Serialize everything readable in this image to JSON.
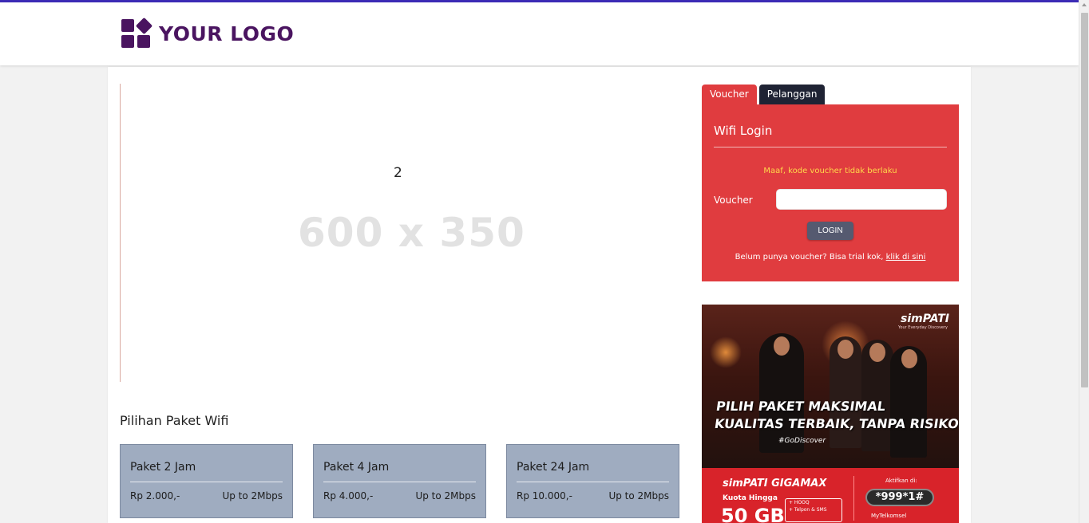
{
  "header": {
    "logo_text": "YOUR LOGO"
  },
  "slider": {
    "slide_number": "2",
    "placeholder_text": "600 x 350"
  },
  "packages": {
    "title": "Pilihan Paket Wifi",
    "items": [
      {
        "name": "Paket 2 Jam",
        "price": "Rp 2.000,-",
        "speed": "Up to 2Mbps"
      },
      {
        "name": "Paket 4 Jam",
        "price": "Rp 4.000,-",
        "speed": "Up to 2Mbps"
      },
      {
        "name": "Paket 24 Jam",
        "price": "Rp 10.000,-",
        "speed": "Up to 2Mbps"
      }
    ]
  },
  "login": {
    "tabs": [
      {
        "label": "Voucher",
        "active": true
      },
      {
        "label": "Pelanggan",
        "active": false
      }
    ],
    "title": "Wifi Login",
    "error": "Maaf, kode voucher tidak berlaku",
    "voucher_label": "Voucher",
    "voucher_value": "",
    "button_label": "LOGIN",
    "trial_text": "Belum punya voucher? Bisa trial kok,",
    "trial_link": "klik di sini"
  },
  "ad": {
    "brand": "simPATI",
    "brand_sub": "Your Everyday Discovery",
    "headline1": "PILIH PAKET MAKSIMAL",
    "headline2": "KUALITAS TERBAIK, TANPA RISIKO",
    "hashtag": "#GoDiscover",
    "product": "simPATI GIGAMAX",
    "quota_label": "Kuota Hingga",
    "quota_value": "50 GB",
    "features": [
      "+ HOOQ",
      "+ Telpon & SMS"
    ],
    "activate_label": "Aktifkan di:",
    "code": "*999*1#",
    "app_name": "MyTelkomsel"
  },
  "colors": {
    "accent_red": "#e03c3f",
    "tab_dark": "#1f2334",
    "logo_purple": "#4a1460",
    "top_border": "#3b2bb5",
    "package_bg": "#9facc0",
    "error_yellow": "#ffd84a"
  }
}
